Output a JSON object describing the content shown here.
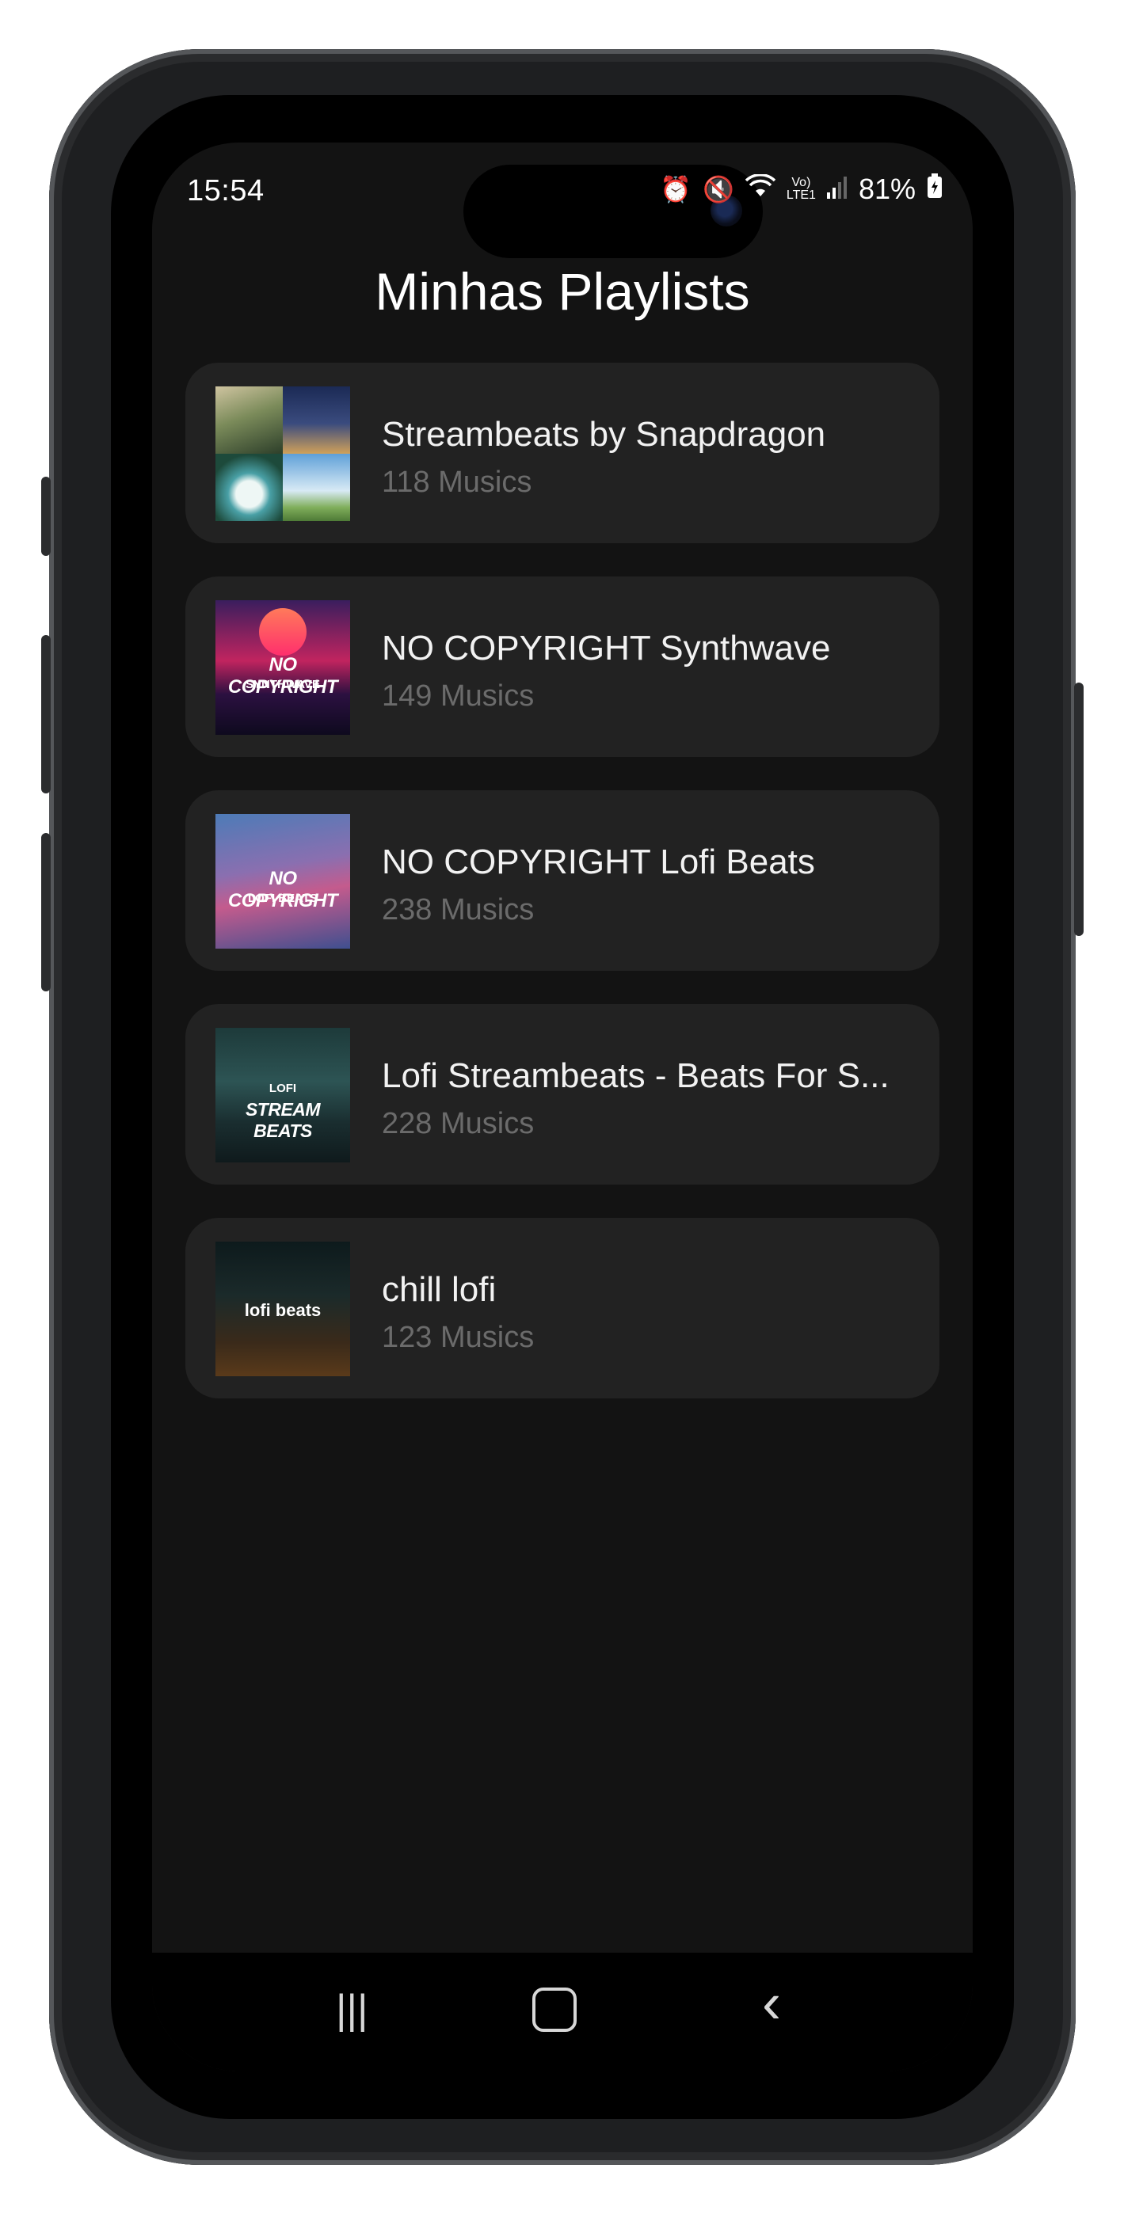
{
  "status_bar": {
    "time": "15:54",
    "network_label_top": "Vo)",
    "network_label_bottom": "LTE1",
    "battery": "81%",
    "icons": [
      "alarm-icon",
      "mute-icon",
      "wifi-icon",
      "signal-icon",
      "battery-icon"
    ]
  },
  "header": {
    "title": "Minhas Playlists"
  },
  "playlists": [
    {
      "name": "Streambeats by Snapdragon",
      "count": "118 Musics",
      "thumb_text": []
    },
    {
      "name": "NO COPYRIGHT Synthwave",
      "count": "149 Musics",
      "thumb_text": [
        "NO COPYRIGHT",
        "SYNTHWAVE"
      ]
    },
    {
      "name": "NO COPYRIGHT Lofi Beats",
      "count": "238 Musics",
      "thumb_text": [
        "NO COPYRIGHT",
        "LOFI BEATS"
      ]
    },
    {
      "name": "Lofi Streambeats - Beats For S...",
      "count": "228 Musics",
      "thumb_text": [
        "LOFI",
        "STREAM BEATS"
      ]
    },
    {
      "name": "chill lofi",
      "count": "123 Musics",
      "thumb_text": [
        "lofi beats"
      ]
    }
  ],
  "nav_bar": {
    "recent_glyph": "|||",
    "back_glyph": "‹",
    "icons": [
      "recent-apps-icon",
      "home-icon",
      "back-icon"
    ]
  },
  "colors": {
    "background": "#131313",
    "card": "#222222",
    "title_text": "#ffffff",
    "secondary_text": "#6b6b6b"
  }
}
